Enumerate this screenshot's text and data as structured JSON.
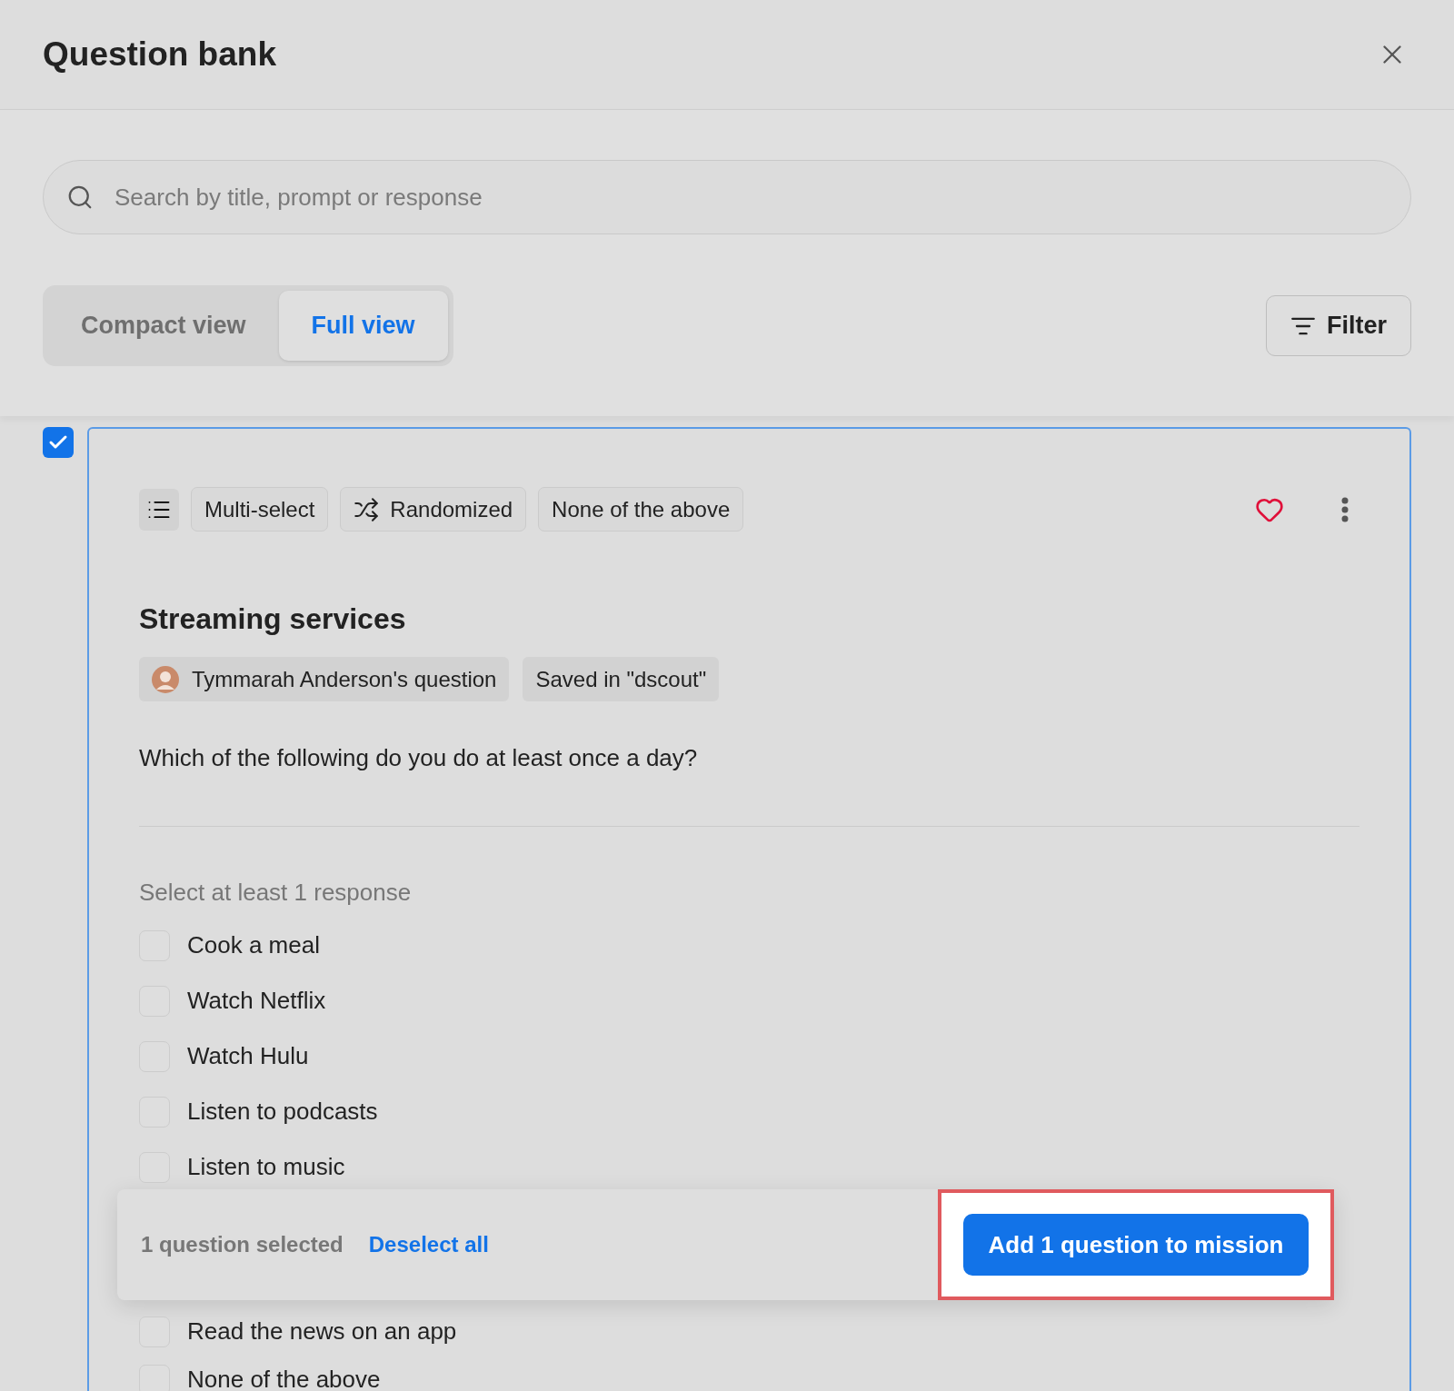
{
  "dialog": {
    "title": "Question bank"
  },
  "search": {
    "placeholder": "Search by title, prompt or response"
  },
  "view_tabs": [
    {
      "label": "Compact view",
      "selected": false
    },
    {
      "label": "Full view",
      "selected": true
    }
  ],
  "filter_button": {
    "label": "Filter"
  },
  "question": {
    "checked": true,
    "favorite": true,
    "type_tags": [
      {
        "kind": "icon"
      },
      {
        "kind": "text",
        "label": "Multi-select"
      },
      {
        "kind": "shuffle",
        "label": "Randomized"
      },
      {
        "kind": "text",
        "label": "None of the above"
      }
    ],
    "title": "Streaming services",
    "meta_tags": [
      {
        "kind": "author",
        "label": "Tymmarah Anderson's question"
      },
      {
        "kind": "text",
        "label": "Saved in \"dscout\""
      }
    ],
    "prompt": "Which of the following do you do at least once a day?",
    "hint": "Select at least 1 response",
    "options": [
      {
        "label": "Cook a meal",
        "checked": false
      },
      {
        "label": "Watch Netflix",
        "checked": false
      },
      {
        "label": "Watch Hulu",
        "checked": false
      },
      {
        "label": "Listen to podcasts",
        "checked": false
      },
      {
        "label": "Listen to music",
        "checked": false
      }
    ],
    "options_after_bar": [
      {
        "label": "Read the news on an app",
        "checked": false
      },
      {
        "label": "None of the above",
        "checked": false
      }
    ]
  },
  "selection_bar": {
    "count": "1 question selected",
    "deselect": "Deselect all",
    "action": "Add 1 question to mission",
    "highlighted": true
  }
}
